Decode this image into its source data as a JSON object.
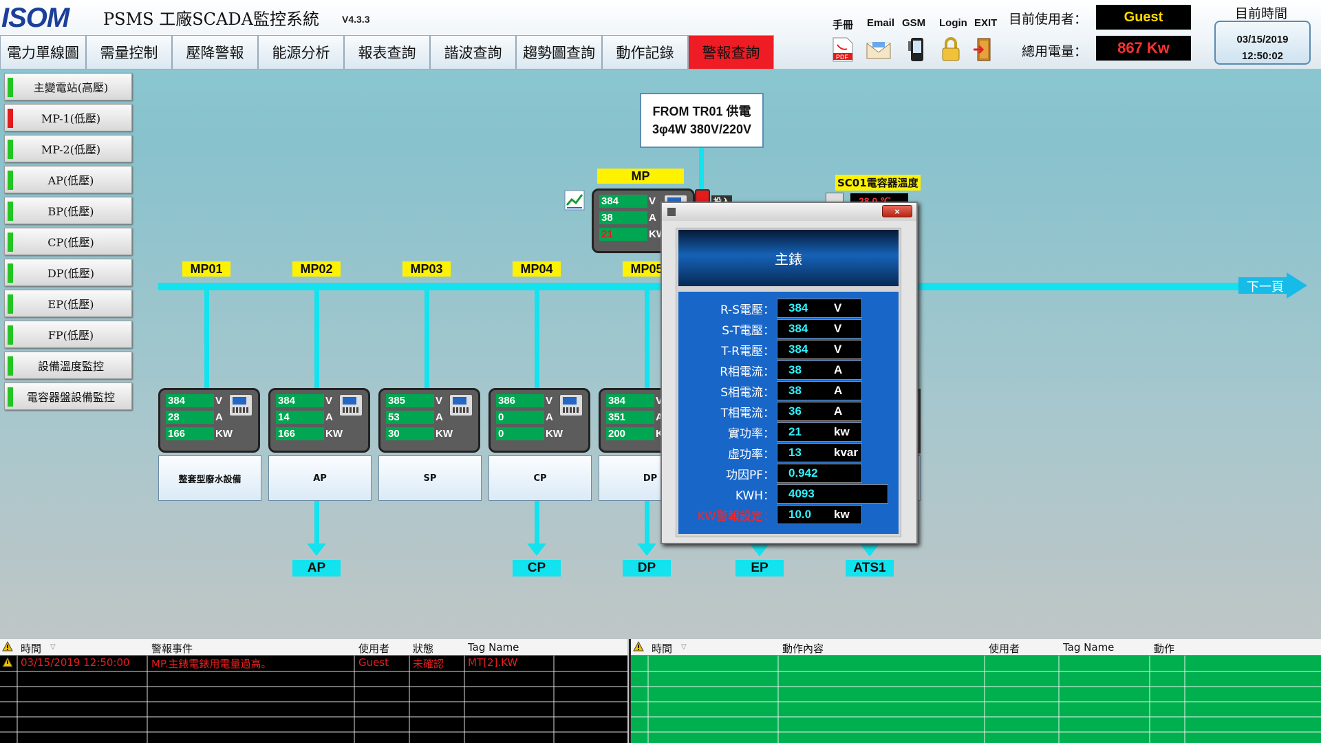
{
  "header": {
    "logo": "ISOM",
    "app_title": "PSMS 工廠SCADA監控系統",
    "version": "V4.3.3",
    "icon_labels": [
      "手冊",
      "Email",
      "GSM",
      "Login",
      "EXIT"
    ],
    "current_user_label": "目前使用者：",
    "current_user": "Guest",
    "total_power_label": "總用電量：",
    "total_power": "867 Kw",
    "time_label": "目前時間",
    "date": "03/15/2019",
    "time": "12:50:02"
  },
  "nav": {
    "tabs": [
      "電力單線圖",
      "需量控制",
      "壓降警報",
      "能源分析",
      "報表查詢",
      "諧波查詢",
      "趨勢圖查詢",
      "動作記錄",
      "警報查詢"
    ],
    "active_index": 8
  },
  "sidebar": {
    "items": [
      {
        "label": "主變電站(高壓)",
        "status": "green"
      },
      {
        "label": "MP-1(低壓)",
        "status": "red"
      },
      {
        "label": "MP-2(低壓)",
        "status": "green"
      },
      {
        "label": "AP(低壓)",
        "status": "green"
      },
      {
        "label": "BP(低壓)",
        "status": "green"
      },
      {
        "label": "CP(低壓)",
        "status": "green"
      },
      {
        "label": "DP(低壓)",
        "status": "green"
      },
      {
        "label": "EP(低壓)",
        "status": "green"
      },
      {
        "label": "FP(低壓)",
        "status": "green"
      },
      {
        "label": "設備溫度監控",
        "status": "green"
      },
      {
        "label": "電容器盤設備監控",
        "status": "green"
      }
    ]
  },
  "diagram": {
    "source_line1": "FROM TR01 供電",
    "source_line2": "3φ4W 380V/220V",
    "main_meter_label": "MP",
    "main_meter": {
      "v": "384",
      "a": "38",
      "kw": "21"
    },
    "main_switch_label": "投入",
    "sc01_label": "SC01電容器溫度",
    "sc01_value": "28.0 ℃",
    "next_page": "下一頁",
    "unit_v": "V",
    "unit_a": "A",
    "unit_kw": "KW",
    "feeders": [
      {
        "label": "MP01",
        "v": "384",
        "a": "28",
        "kw": "166",
        "load": "整套型廢水設備",
        "dest": "",
        "status": "on"
      },
      {
        "label": "MP02",
        "v": "384",
        "a": "14",
        "kw": "166",
        "load": "AP",
        "dest": "AP",
        "status": "on"
      },
      {
        "label": "MP03",
        "v": "385",
        "a": "53",
        "kw": "30",
        "load": "SP",
        "dest": "",
        "status": "on"
      },
      {
        "label": "MP04",
        "v": "386",
        "a": "0",
        "kw": "0",
        "load": "CP",
        "dest": "CP",
        "status": "on"
      },
      {
        "label": "MP05",
        "v": "384",
        "a": "351",
        "kw": "200",
        "load": "DP",
        "dest": "DP",
        "status": "on"
      }
    ],
    "extra_dests": [
      "EP",
      "ATS1"
    ]
  },
  "popup": {
    "close": "×",
    "title": "主錶",
    "rows": [
      {
        "label": "R-S電壓：",
        "value": "384",
        "unit": "V",
        "wide": false,
        "alarm": false
      },
      {
        "label": "S-T電壓：",
        "value": "384",
        "unit": "V",
        "wide": false,
        "alarm": false
      },
      {
        "label": "T-R電壓：",
        "value": "384",
        "unit": "V",
        "wide": false,
        "alarm": false
      },
      {
        "label": "R相電流：",
        "value": "38",
        "unit": "A",
        "wide": false,
        "alarm": false
      },
      {
        "label": "S相電流：",
        "value": "38",
        "unit": "A",
        "wide": false,
        "alarm": false
      },
      {
        "label": "T相電流：",
        "value": "36",
        "unit": "A",
        "wide": false,
        "alarm": false
      },
      {
        "label": "實功率：",
        "value": "21",
        "unit": "kw",
        "wide": false,
        "alarm": false
      },
      {
        "label": "虛功率：",
        "value": "13",
        "unit": "kvar",
        "wide": false,
        "alarm": false
      },
      {
        "label": "功因PF：",
        "value": "0.942",
        "unit": "",
        "wide": false,
        "alarm": false
      },
      {
        "label": "KWH：",
        "value": "4093",
        "unit": "",
        "wide": true,
        "alarm": false
      },
      {
        "label": "KW警報設定：",
        "value": "10.0",
        "unit": "kw",
        "wide": false,
        "alarm": true
      }
    ]
  },
  "alarm_grid": {
    "headers": [
      "時間",
      "警報事件",
      "使用者",
      "狀態",
      "Tag Name"
    ],
    "rows": [
      [
        "03/15/2019 12:50:00",
        "MP.主錶電錶用電量過高。",
        "Guest",
        "未確認",
        "MT[2].KW"
      ]
    ]
  },
  "action_grid": {
    "headers": [
      "時間",
      "動作內容",
      "使用者",
      "Tag Name",
      "動作"
    ],
    "rows": []
  },
  "colors": {
    "bus": "#12e3ee",
    "meter_value_bg": "#00a651",
    "alarm_red": "#ee1c24",
    "label_yellow": "#fff200",
    "popup_blue": "#1866c8",
    "action_grid_bg": "#00b04f"
  }
}
